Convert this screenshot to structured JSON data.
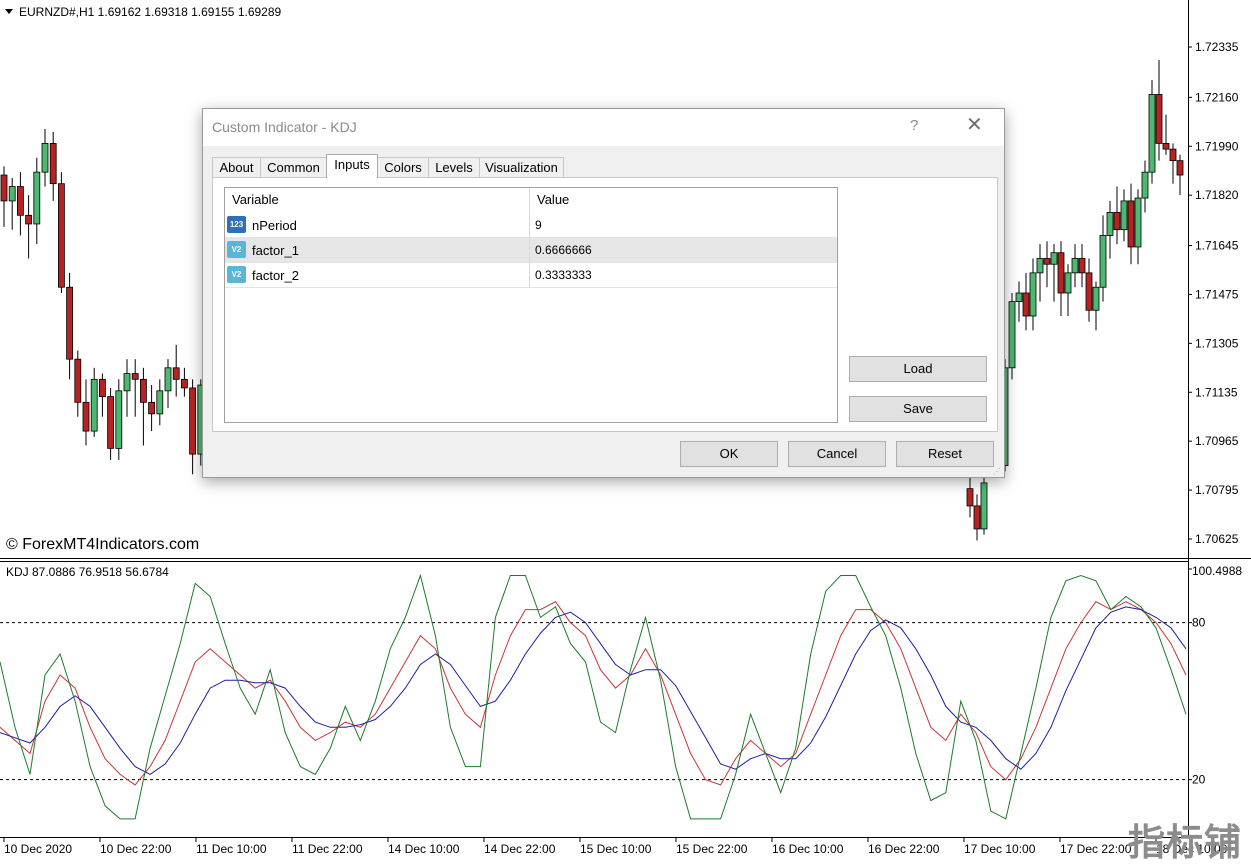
{
  "main_chart": {
    "header": "EURNZD#,H1  1.69162 1.69318 1.69155 1.69289",
    "copyright": "© ForexMT4Indicators.com",
    "price_axis": [
      "1.72335",
      "1.72160",
      "1.71990",
      "1.71820",
      "1.71645",
      "1.71475",
      "1.71305",
      "1.71135",
      "1.70965",
      "1.70795",
      "1.70625"
    ],
    "colors": {
      "bull": "#4fb870",
      "bear": "#b52424",
      "wick": "#000000"
    }
  },
  "indicator_pane": {
    "header": "KDJ 87.0886 76.9518 56.6784",
    "axis_labels": [
      "100.4988",
      "80",
      "20"
    ],
    "colors": {
      "k": "#c8363a",
      "d": "#1e1e9c",
      "j": "#1e7a2b",
      "level": "#000000"
    }
  },
  "time_axis": [
    "10 Dec 2020",
    "10 Dec 22:00",
    "11 Dec 10:00",
    "11 Dec 22:00",
    "14 Dec 10:00",
    "14 Dec 22:00",
    "15 Dec 10:00",
    "15 Dec 22:00",
    "16 Dec 10:00",
    "16 Dec 22:00",
    "17 Dec 10:00",
    "17 Dec 22:00",
    "18 Dec 10:00"
  ],
  "chart_data": {
    "type": "candlestick",
    "symbol": "EURNZD#",
    "timeframe": "H1",
    "ohlc_current": {
      "open": 1.69162,
      "high": 1.69318,
      "low": 1.69155,
      "close": 1.69289
    },
    "y_ticks": [
      1.72335,
      1.7216,
      1.7199,
      1.7182,
      1.71645,
      1.71475,
      1.71305,
      1.71135,
      1.70965,
      1.70795,
      1.70625
    ],
    "x_ticks": [
      "10 Dec 2020",
      "10 Dec 22:00",
      "11 Dec 10:00",
      "11 Dec 22:00",
      "14 Dec 10:00",
      "14 Dec 22:00",
      "15 Dec 10:00",
      "15 Dec 22:00",
      "16 Dec 10:00",
      "16 Dec 22:00",
      "17 Dec 10:00",
      "17 Dec 22:00",
      "18 Dec 10:00"
    ],
    "candles_left": [
      [
        1.7189,
        1.7192,
        1.7171,
        1.718
      ],
      [
        1.718,
        1.7188,
        1.717,
        1.7185
      ],
      [
        1.7185,
        1.719,
        1.7168,
        1.7175
      ],
      [
        1.7175,
        1.7182,
        1.716,
        1.7172
      ],
      [
        1.7172,
        1.7195,
        1.7165,
        1.719
      ],
      [
        1.719,
        1.7205,
        1.7185,
        1.72
      ],
      [
        1.72,
        1.7204,
        1.718,
        1.7186
      ],
      [
        1.7186,
        1.719,
        1.7148,
        1.715
      ],
      [
        1.715,
        1.7155,
        1.7118,
        1.7125
      ],
      [
        1.7125,
        1.7128,
        1.7105,
        1.711
      ],
      [
        1.711,
        1.7118,
        1.7095,
        1.71
      ],
      [
        1.71,
        1.7122,
        1.7098,
        1.7118
      ],
      [
        1.7118,
        1.712,
        1.7105,
        1.7112
      ],
      [
        1.7112,
        1.7115,
        1.709,
        1.7094
      ],
      [
        1.7094,
        1.7118,
        1.709,
        1.7114
      ],
      [
        1.7114,
        1.7125,
        1.7105,
        1.712
      ],
      [
        1.712,
        1.7125,
        1.7105,
        1.7118
      ],
      [
        1.7118,
        1.7122,
        1.7095,
        1.711
      ],
      [
        1.711,
        1.7116,
        1.71,
        1.7106
      ],
      [
        1.7106,
        1.7118,
        1.7102,
        1.7114
      ],
      [
        1.7114,
        1.7125,
        1.7108,
        1.7122
      ],
      [
        1.7122,
        1.713,
        1.7112,
        1.7118
      ],
      [
        1.7118,
        1.7122,
        1.7112,
        1.7115
      ],
      [
        1.7115,
        1.7118,
        1.7085,
        1.7092
      ],
      [
        1.7092,
        1.7118,
        1.7088,
        1.7116
      ]
    ],
    "candles_right": [
      [
        1.708,
        1.7086,
        1.707,
        1.7074
      ],
      [
        1.7074,
        1.7078,
        1.7062,
        1.7066
      ],
      [
        1.7066,
        1.7084,
        1.7064,
        1.7082
      ],
      [
        1.7088,
        1.7102,
        1.7084,
        1.7098
      ],
      [
        1.7098,
        1.71,
        1.7085,
        1.7088
      ],
      [
        1.7088,
        1.7125,
        1.7086,
        1.7122
      ],
      [
        1.7122,
        1.7148,
        1.7118,
        1.7145
      ],
      [
        1.7145,
        1.7152,
        1.7138,
        1.7148
      ],
      [
        1.7148,
        1.7155,
        1.7135,
        1.714
      ],
      [
        1.714,
        1.716,
        1.7135,
        1.7155
      ],
      [
        1.7155,
        1.7165,
        1.7145,
        1.716
      ],
      [
        1.716,
        1.7166,
        1.715,
        1.7158
      ],
      [
        1.7158,
        1.7165,
        1.7145,
        1.7162
      ],
      [
        1.7162,
        1.7166,
        1.714,
        1.7148
      ],
      [
        1.7148,
        1.7158,
        1.714,
        1.7155
      ],
      [
        1.7155,
        1.7165,
        1.715,
        1.716
      ],
      [
        1.716,
        1.7165,
        1.715,
        1.7155
      ],
      [
        1.7155,
        1.716,
        1.7138,
        1.7142
      ],
      [
        1.7142,
        1.7152,
        1.7135,
        1.715
      ],
      [
        1.715,
        1.7175,
        1.7145,
        1.7168
      ],
      [
        1.7168,
        1.718,
        1.716,
        1.7176
      ],
      [
        1.7176,
        1.7185,
        1.7165,
        1.717
      ],
      [
        1.717,
        1.7184,
        1.7166,
        1.718
      ],
      [
        1.718,
        1.7186,
        1.7158,
        1.7164
      ],
      [
        1.7164,
        1.7184,
        1.7158,
        1.7181
      ],
      [
        1.7181,
        1.7194,
        1.7176,
        1.719
      ],
      [
        1.719,
        1.7222,
        1.7186,
        1.7217
      ],
      [
        1.7217,
        1.7229,
        1.7194,
        1.72
      ],
      [
        1.72,
        1.721,
        1.7196,
        1.7198
      ],
      [
        1.7198,
        1.72,
        1.7186,
        1.7194
      ],
      [
        1.7194,
        1.7196,
        1.7182,
        1.7189
      ]
    ],
    "kdj_pane": {
      "range": [
        0,
        100.4988
      ],
      "levels": [
        80,
        20
      ],
      "current": {
        "K": 87.0886,
        "D": 76.9518,
        "J": 56.6784
      },
      "series": [
        {
          "name": "K",
          "values": [
            40,
            35,
            30,
            50,
            60,
            55,
            40,
            28,
            22,
            18,
            25,
            35,
            50,
            65,
            70,
            65,
            60,
            55,
            58,
            50,
            40,
            35,
            38,
            42,
            40,
            45,
            55,
            65,
            75,
            70,
            55,
            45,
            40,
            60,
            75,
            85,
            85,
            88,
            80,
            75,
            62,
            55,
            60,
            70,
            60,
            45,
            30,
            20,
            18,
            28,
            35,
            30,
            25,
            30,
            45,
            60,
            75,
            85,
            85,
            80,
            70,
            55,
            40,
            35,
            45,
            38,
            25,
            20,
            28,
            40,
            55,
            70,
            80,
            88,
            85,
            88,
            85,
            80,
            72,
            60
          ]
        },
        {
          "name": "D",
          "values": [
            38,
            36,
            34,
            40,
            48,
            52,
            48,
            40,
            32,
            25,
            22,
            26,
            34,
            45,
            55,
            58,
            58,
            57,
            57,
            55,
            48,
            42,
            40,
            40,
            41,
            43,
            48,
            55,
            64,
            68,
            64,
            56,
            48,
            50,
            58,
            68,
            76,
            82,
            84,
            80,
            72,
            64,
            60,
            62,
            62,
            56,
            46,
            36,
            26,
            24,
            28,
            30,
            28,
            28,
            34,
            44,
            56,
            68,
            77,
            81,
            78,
            70,
            60,
            48,
            42,
            40,
            35,
            28,
            24,
            30,
            40,
            54,
            66,
            78,
            84,
            86,
            85,
            82,
            78,
            70
          ]
        },
        {
          "name": "J",
          "values": [
            65,
            40,
            22,
            60,
            68,
            50,
            25,
            10,
            5,
            5,
            32,
            52,
            72,
            95,
            90,
            72,
            55,
            45,
            62,
            38,
            25,
            22,
            32,
            48,
            35,
            50,
            70,
            82,
            98,
            75,
            40,
            25,
            25,
            82,
            98,
            98,
            82,
            86,
            72,
            65,
            42,
            38,
            62,
            82,
            58,
            25,
            5,
            5,
            5,
            22,
            45,
            30,
            15,
            32,
            68,
            92,
            98,
            98,
            86,
            75,
            55,
            30,
            12,
            15,
            50,
            35,
            8,
            5,
            30,
            55,
            82,
            96,
            98,
            96,
            85,
            90,
            86,
            78,
            62,
            45
          ]
        }
      ]
    }
  },
  "dialog": {
    "title": "Custom Indicator - KDJ",
    "help": "?",
    "close": "✕",
    "tabs": [
      "About",
      "Common",
      "Inputs",
      "Colors",
      "Levels",
      "Visualization"
    ],
    "active_tab": "Inputs",
    "grid": {
      "headers": [
        "Variable",
        "Value"
      ],
      "rows": [
        {
          "icon": "123",
          "name": "nPeriod",
          "value": "9"
        },
        {
          "icon": "V2",
          "name": "factor_1",
          "value": "0.6666666"
        },
        {
          "icon": "V2",
          "name": "factor_2",
          "value": "0.3333333"
        }
      ]
    },
    "buttons": {
      "load": "Load",
      "save": "Save",
      "ok": "OK",
      "cancel": "Cancel",
      "reset": "Reset"
    }
  },
  "watermark": "指标铺"
}
